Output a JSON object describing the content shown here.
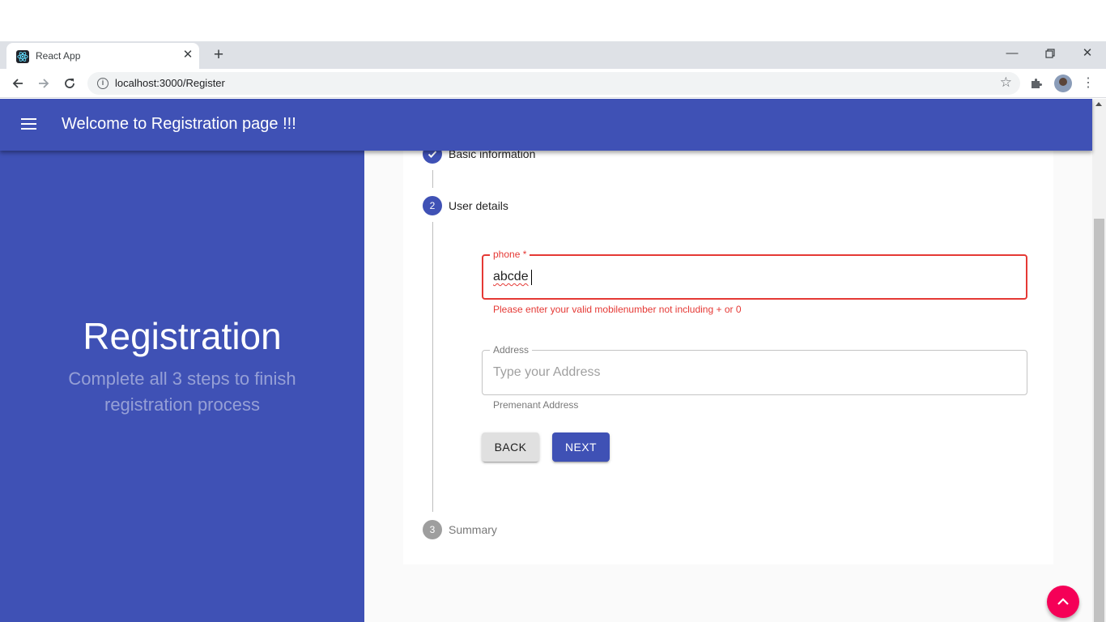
{
  "browser": {
    "tab_title": "React App",
    "url": "localhost:3000/Register"
  },
  "app": {
    "title": "Welcome to Registration page !!!"
  },
  "left_panel": {
    "title": "Registration",
    "subtitle": "Complete all 3 steps to finish registration process"
  },
  "stepper": {
    "steps": [
      {
        "index": "1",
        "label": "Basic information",
        "state": "completed"
      },
      {
        "index": "2",
        "label": "User details",
        "state": "active"
      },
      {
        "index": "3",
        "label": "Summary",
        "state": "pending"
      }
    ]
  },
  "form": {
    "phone": {
      "label": "phone *",
      "value": "abcde",
      "error": "Please enter your valid mobilenumber not including + or 0"
    },
    "address": {
      "label": "Address",
      "placeholder": "Type your Address",
      "helper": "Premenant Address"
    },
    "back_label": "BACK",
    "next_label": "NEXT"
  },
  "colors": {
    "primary": "#3f51b5",
    "error": "#e53935",
    "secondary": "#f50057"
  },
  "icons": {
    "menu": "menu-icon",
    "check": "check-icon",
    "scroll_top": "arrow-up-icon"
  }
}
